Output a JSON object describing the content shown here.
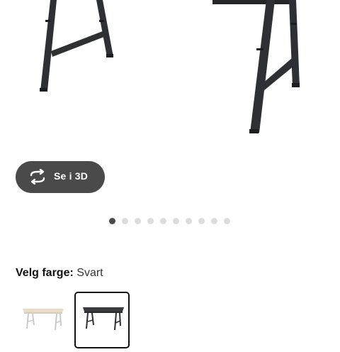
{
  "viewer": {
    "button_3d_label": "Se i 3D",
    "rotate_icon": "rotate-3d-icon"
  },
  "gallery": {
    "total_images": 10,
    "active_index": 0
  },
  "color_picker": {
    "label": "Velg farge:",
    "selected_value": "Svart",
    "options": [
      {
        "name": "white-beige-desk",
        "selected": false
      },
      {
        "name": "black-desk",
        "selected": true
      }
    ]
  },
  "colors": {
    "button_bg": "#4a4a4a",
    "frame": "#2f3033",
    "dot_inactive": "#dcdcdc",
    "dot_active": "#4a4a4a"
  }
}
